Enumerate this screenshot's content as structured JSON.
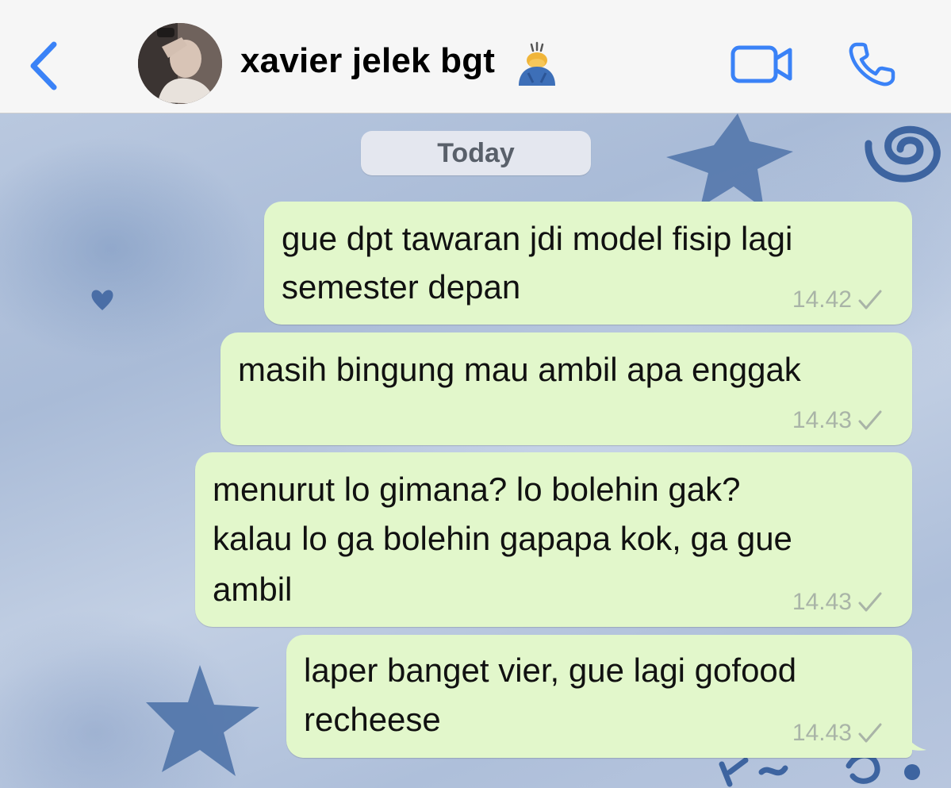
{
  "header": {
    "back_icon": "chevron-left-icon",
    "contact_name": "xavier jelek bgt",
    "contact_emoji": "person-bowing-emoji-icon",
    "video_icon": "video-camera-icon",
    "call_icon": "phone-icon",
    "accent_color": "#3a82f7"
  },
  "chat": {
    "date_label": "Today",
    "bubble_color": "#e2f7cb",
    "messages": [
      {
        "lines": [
          "gue dpt tawaran jdi model fisip lagi",
          "semester depan"
        ],
        "time": "14.42",
        "status": "sent-check-icon"
      },
      {
        "lines": [
          "masih bingung mau ambil apa enggak"
        ],
        "time": "14.43",
        "status": "sent-check-icon"
      },
      {
        "lines": [
          "menurut lo gimana? lo bolehin gak?",
          "kalau lo ga bolehin gapapa kok, ga gue",
          "ambil"
        ],
        "time": "14.43",
        "status": "sent-check-icon"
      },
      {
        "lines": [
          "laper banget vier, gue lagi gofood",
          "recheese"
        ],
        "time": "14.43",
        "status": "sent-check-icon"
      }
    ]
  }
}
